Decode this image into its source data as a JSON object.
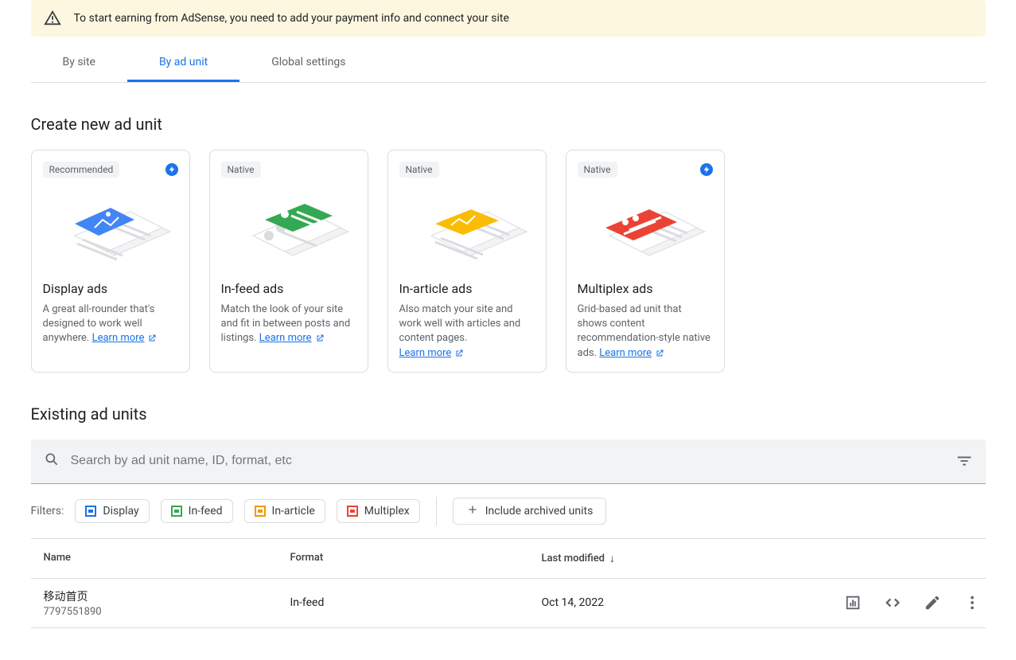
{
  "banner": {
    "text": "To start earning from AdSense, you need to add your payment info and connect your site"
  },
  "tabs": {
    "by_site": "By site",
    "by_ad_unit": "By ad unit",
    "global_settings": "Global settings"
  },
  "create_section_title": "Create new ad unit",
  "cards": [
    {
      "chip": "Recommended",
      "title": "Display ads",
      "desc": "A great all-rounder that's designed to work well anywhere.",
      "learn": "Learn more",
      "bolt": true,
      "accent": "#4285f4"
    },
    {
      "chip": "Native",
      "title": "In-feed ads",
      "desc": "Match the look of your site and fit in between posts and listings.",
      "learn": "Learn more",
      "bolt": false,
      "accent": "#34a853"
    },
    {
      "chip": "Native",
      "title": "In-article ads",
      "desc": "Also match your site and work well with articles and content pages.",
      "learn": "Learn more",
      "bolt": false,
      "accent": "#fbbc04"
    },
    {
      "chip": "Native",
      "title": "Multiplex ads",
      "desc": "Grid-based ad unit that shows content recommendation-style native ads.",
      "learn": "Learn more",
      "bolt": true,
      "accent": "#ea4335"
    }
  ],
  "existing_section_title": "Existing ad units",
  "search": {
    "placeholder": "Search by ad unit name, ID, format, etc"
  },
  "filters": {
    "label": "Filters:",
    "display": "Display",
    "in_feed": "In-feed",
    "in_article": "In-article",
    "multiplex": "Multiplex",
    "archived": "Include archived units"
  },
  "table": {
    "headers": {
      "name": "Name",
      "format": "Format",
      "last_modified": "Last modified"
    },
    "rows": [
      {
        "name": "移动首页",
        "id": "7797551890",
        "format": "In-feed",
        "last_modified": "Oct 14, 2022"
      }
    ]
  }
}
